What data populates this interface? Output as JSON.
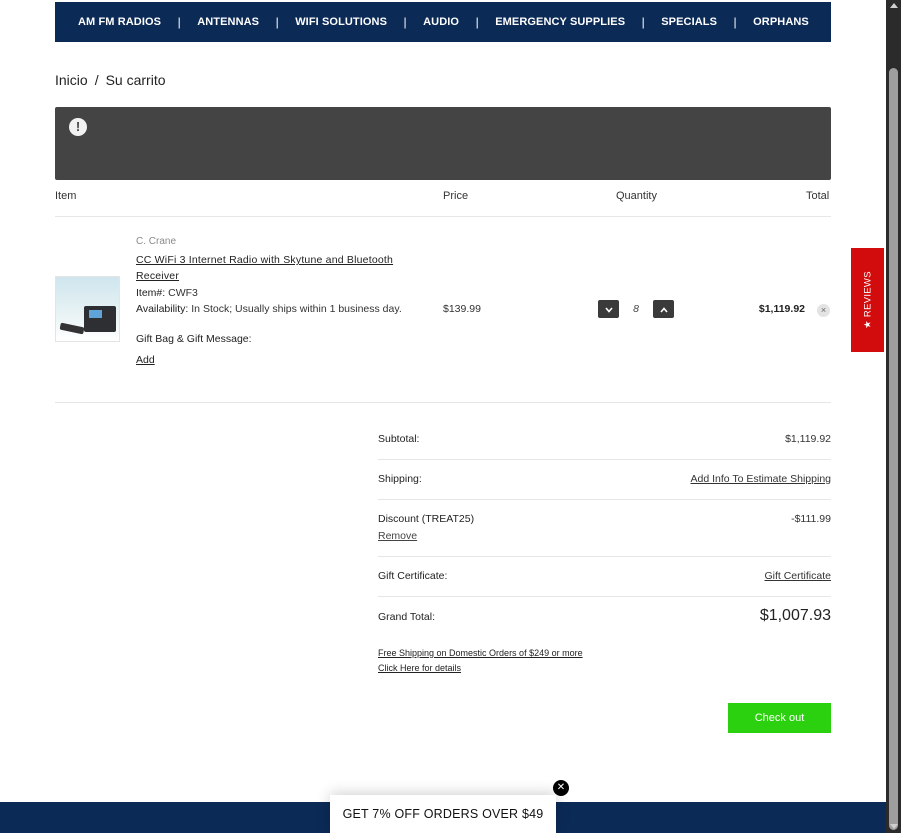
{
  "nav": {
    "items": [
      "AM FM RADIOS",
      "ANTENNAS",
      "WIFI SOLUTIONS",
      "AUDIO",
      "EMERGENCY SUPPLIES",
      "SPECIALS",
      "ORPHANS"
    ],
    "separator": "|"
  },
  "breadcrumb": {
    "home": "Inicio",
    "sep": "/",
    "current": "Su carrito"
  },
  "alert": {
    "icon": "exclamation-circle-icon",
    "icon_glyph": "!"
  },
  "table": {
    "headers": {
      "item": "Item",
      "price": "Price",
      "quantity": "Quantity",
      "total": "Total"
    }
  },
  "item": {
    "brand": "C. Crane",
    "name": "CC WiFi 3 Internet Radio with Skytune and Bluetooth Receiver",
    "sku_label": "Item#:",
    "sku": "CWF3",
    "availability_label": "Availability:",
    "availability": "In Stock; Usually ships within 1 business day.",
    "gift_label": "Gift Bag & Gift Message:",
    "gift_add": "Add",
    "price": "$139.99",
    "quantity": "8",
    "total": "$1,119.92",
    "remove_glyph": "×"
  },
  "totals": {
    "subtotal_label": "Subtotal:",
    "subtotal": "$1,119.92",
    "shipping_label": "Shipping:",
    "shipping_link": "Add Info To Estimate Shipping",
    "discount_label": "Discount (TREAT25)",
    "discount": "-$111.99",
    "discount_remove": "Remove",
    "gift_cert_label": "Gift Certificate:",
    "gift_cert_link": "Gift Certificate",
    "grand_total_label": "Grand Total:",
    "grand_total": "$1,007.93",
    "free_shipping_line1": "Free Shipping on Domestic Orders of $249 or more",
    "free_shipping_line2": "Click Here for details"
  },
  "checkout": {
    "label": "Check out",
    "color": "#2bd10e"
  },
  "promo": {
    "text": "GET 7% OFF ORDERS OVER $49",
    "close_glyph": "✕"
  },
  "reviews_tab": {
    "label": "★ REVIEWS",
    "color": "#d20c0c"
  },
  "colors": {
    "nav_bg": "#0b2a56",
    "alert_bg": "#444444"
  }
}
